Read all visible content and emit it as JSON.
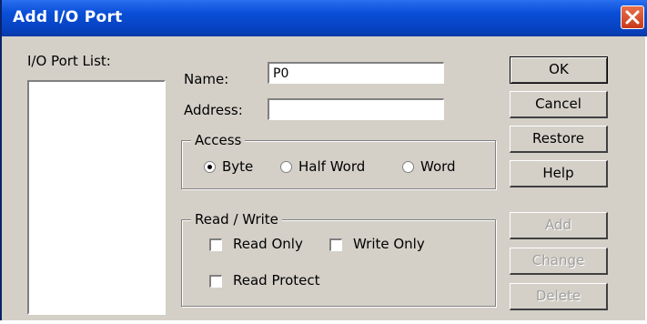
{
  "window": {
    "title": "Add I/O Port"
  },
  "port_list": {
    "label": "I/O Port List:",
    "items": []
  },
  "name_field": {
    "label": "Name:",
    "value": "P0"
  },
  "address_field": {
    "label": "Address:",
    "value": ""
  },
  "access_group": {
    "title": "Access",
    "options": [
      {
        "label": "Byte",
        "checked": true
      },
      {
        "label": "Half Word",
        "checked": false
      },
      {
        "label": "Word",
        "checked": false
      }
    ]
  },
  "rw_group": {
    "title": "Read / Write",
    "read_only": {
      "label": "Read Only",
      "checked": false
    },
    "write_only": {
      "label": "Write Only",
      "checked": false
    },
    "read_protect": {
      "label": "Read Protect",
      "checked": false
    }
  },
  "buttons": {
    "ok": "OK",
    "cancel": "Cancel",
    "restore": "Restore",
    "help": "Help",
    "add": "Add",
    "change": "Change",
    "delete": "Delete"
  },
  "colors": {
    "titlebar": "#0a4fd8",
    "dialog_bg": "#d4d0c8",
    "close": "#d9532e",
    "disabled_text": "#a0a0a0"
  }
}
